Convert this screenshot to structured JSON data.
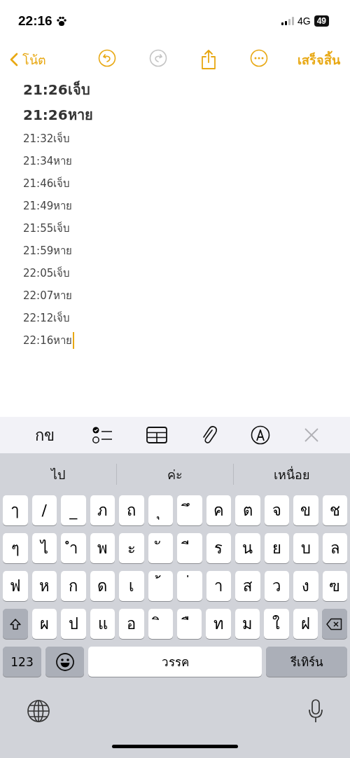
{
  "status_bar": {
    "time": "22:16",
    "network": "4G",
    "battery": "49"
  },
  "nav": {
    "back": "โน้ต",
    "done": "เสร็จสิ้น",
    "redo_disabled": true
  },
  "note": {
    "headings": [
      "21:26เจ็บ",
      "21:26หาย"
    ],
    "lines": [
      "21:32เจ็บ",
      "21:34หาย",
      "21:46เจ็บ",
      "21:49หาย",
      "21:55เจ็บ",
      "21:59หาย",
      "22:05เจ็บ",
      "22:07หาย",
      "22:12เจ็บ",
      "22:16หาย"
    ]
  },
  "format_toolbar": {
    "text_style": "กข"
  },
  "suggestions": [
    "ไป",
    "ค่ะ",
    "เหนื่อย"
  ],
  "keyboard": {
    "rows": [
      [
        {
          "kind": "letter",
          "label": "ๅ"
        },
        {
          "kind": "letter",
          "label": "/"
        },
        {
          "kind": "letter",
          "label": "_"
        },
        {
          "kind": "letter",
          "label": "ภ"
        },
        {
          "kind": "letter",
          "label": "ถ"
        },
        {
          "kind": "letter",
          "label": "ุ"
        },
        {
          "kind": "letter",
          "label": "ึ"
        },
        {
          "kind": "letter",
          "label": "ค"
        },
        {
          "kind": "letter",
          "label": "ต"
        },
        {
          "kind": "letter",
          "label": "จ"
        },
        {
          "kind": "letter",
          "label": "ข"
        },
        {
          "kind": "letter",
          "label": "ช"
        }
      ],
      [
        {
          "kind": "letter",
          "label": "ๆ"
        },
        {
          "kind": "letter",
          "label": "ไ"
        },
        {
          "kind": "letter",
          "label": "ำ"
        },
        {
          "kind": "letter",
          "label": "พ"
        },
        {
          "kind": "letter",
          "label": "ะ"
        },
        {
          "kind": "letter",
          "label": "ั"
        },
        {
          "kind": "letter",
          "label": "ี"
        },
        {
          "kind": "letter",
          "label": "ร"
        },
        {
          "kind": "letter",
          "label": "น"
        },
        {
          "kind": "letter",
          "label": "ย"
        },
        {
          "kind": "letter",
          "label": "บ"
        },
        {
          "kind": "letter",
          "label": "ล"
        }
      ],
      [
        {
          "kind": "letter",
          "label": "ฟ"
        },
        {
          "kind": "letter",
          "label": "ห"
        },
        {
          "kind": "letter",
          "label": "ก"
        },
        {
          "kind": "letter",
          "label": "ด"
        },
        {
          "kind": "letter",
          "label": "เ"
        },
        {
          "kind": "letter",
          "label": "้"
        },
        {
          "kind": "letter",
          "label": "่"
        },
        {
          "kind": "letter",
          "label": "า"
        },
        {
          "kind": "letter",
          "label": "ส"
        },
        {
          "kind": "letter",
          "label": "ว"
        },
        {
          "kind": "letter",
          "label": "ง"
        },
        {
          "kind": "letter",
          "label": "ฃ"
        }
      ],
      [
        {
          "kind": "shift"
        },
        {
          "kind": "letter",
          "label": "ผ"
        },
        {
          "kind": "letter",
          "label": "ป"
        },
        {
          "kind": "letter",
          "label": "แ"
        },
        {
          "kind": "letter",
          "label": "อ"
        },
        {
          "kind": "letter",
          "label": "ิ"
        },
        {
          "kind": "letter",
          "label": "ื"
        },
        {
          "kind": "letter",
          "label": "ท"
        },
        {
          "kind": "letter",
          "label": "ม"
        },
        {
          "kind": "letter",
          "label": "ใ"
        },
        {
          "kind": "letter",
          "label": "ฝ"
        },
        {
          "kind": "delete"
        }
      ]
    ],
    "numbers": "123",
    "space": "วรรค",
    "return": "รีเทิร์น"
  }
}
